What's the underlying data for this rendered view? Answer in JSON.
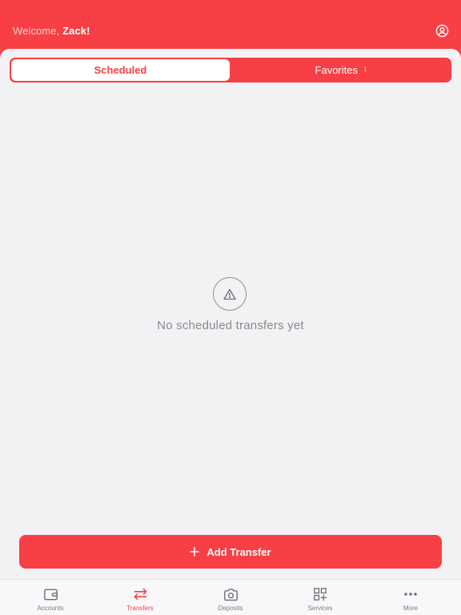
{
  "header": {
    "greeting": "Welcome,",
    "user_name": "Zack!",
    "profile_icon": "user-circle-icon"
  },
  "segments": {
    "scheduled_label": "Scheduled",
    "favorites_label": "Favorites",
    "favorites_count": "1",
    "selected": "Scheduled"
  },
  "empty_state": {
    "icon": "warning-triangle-icon",
    "message": "No scheduled transfers yet"
  },
  "add_button": {
    "label": "Add Transfer",
    "icon": "plus-icon"
  },
  "tabbar": {
    "items": [
      {
        "label": "Accounts",
        "icon": "wallet-icon"
      },
      {
        "label": "Transfers",
        "icon": "transfer-arrows-icon"
      },
      {
        "label": "Deposits",
        "icon": "camera-icon"
      },
      {
        "label": "Services",
        "icon": "grid-plus-icon"
      },
      {
        "label": "More",
        "icon": "more-dots-icon"
      }
    ],
    "active": "Transfers"
  },
  "colors": {
    "brand": "#f73f45",
    "background": "#f2f2f4",
    "muted_text": "#8a8a8e",
    "badge": "#ffc9a8"
  }
}
